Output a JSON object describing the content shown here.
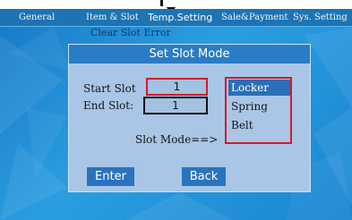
{
  "tabs": [
    {
      "label": "General"
    },
    {
      "label": "Item & Slot"
    },
    {
      "label": "Temp.Setting"
    },
    {
      "label": "Sale&Payment"
    },
    {
      "label": "Sys. Setting"
    }
  ],
  "sub_menu": {
    "label": "Clear Slot Error"
  },
  "dialog": {
    "title": "Set Slot Mode",
    "start_slot_label": "Start Slot",
    "start_slot_value": "1",
    "end_slot_label": "End Slot:",
    "end_slot_value": "1",
    "slot_mode_label": "Slot Mode==>",
    "modes": [
      {
        "label": "Locker",
        "selected": true
      },
      {
        "label": "Spring",
        "selected": false
      },
      {
        "label": "Belt",
        "selected": false
      }
    ],
    "enter_label": "Enter",
    "back_label": "Back"
  },
  "colors": {
    "background": "#1f8fd6",
    "dialog_bg": "#a9c6e6",
    "title_bar": "#2a7cc4",
    "button_bg": "#2a74bd",
    "focus_border": "#d4182c",
    "selected_item": "#2a6fb8"
  },
  "icons": {
    "top_indicator": "down-arrow-icon"
  }
}
